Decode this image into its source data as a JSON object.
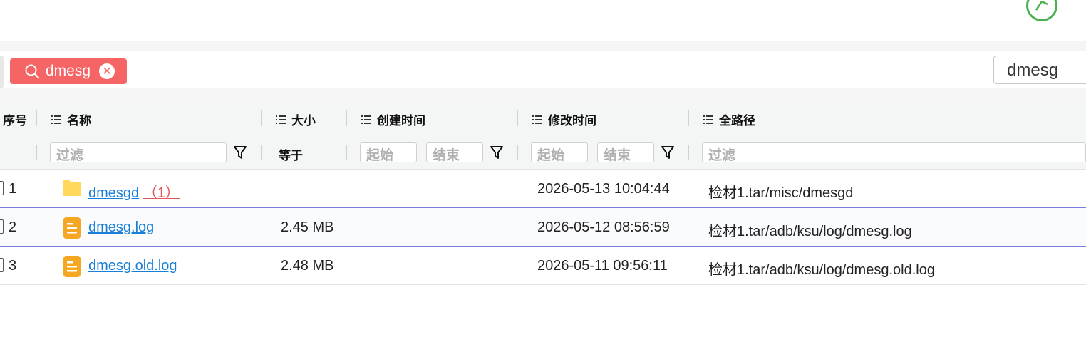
{
  "top": {
    "action_icon": "send-icon",
    "action_icon_color": "#4caf50"
  },
  "search": {
    "tag_label": "dmesg",
    "tag_color": "#f56565",
    "input_value": "dmesg"
  },
  "table": {
    "columns": [
      "序号",
      "名称",
      "大小",
      "创建时间",
      "修改时间",
      "全路径"
    ],
    "filters": {
      "name_placeholder": "过滤",
      "size_operator": "等于",
      "created_start": "起始",
      "created_end": "结束",
      "modified_start": "起始",
      "modified_end": "结束",
      "path_placeholder": "过滤"
    },
    "rows": [
      {
        "index": "1",
        "name": "dmesgd",
        "count": "（1）",
        "type": "folder",
        "size": "",
        "created": "",
        "modified": "2026-05-13 10:04:44",
        "path": "检材1.tar/misc/dmesgd"
      },
      {
        "index": "2",
        "name": "dmesg.log",
        "type": "file",
        "size": "2.45 MB",
        "created": "",
        "modified": "2026-05-12 08:56:59",
        "path": "检材1.tar/adb/ksu/log/dmesg.log"
      },
      {
        "index": "3",
        "name": "dmesg.old.log",
        "type": "file",
        "size": "2.48 MB",
        "created": "",
        "modified": "2026-05-11 09:56:11",
        "path": "检材1.tar/adb/ksu/log/dmesg.old.log"
      }
    ]
  }
}
